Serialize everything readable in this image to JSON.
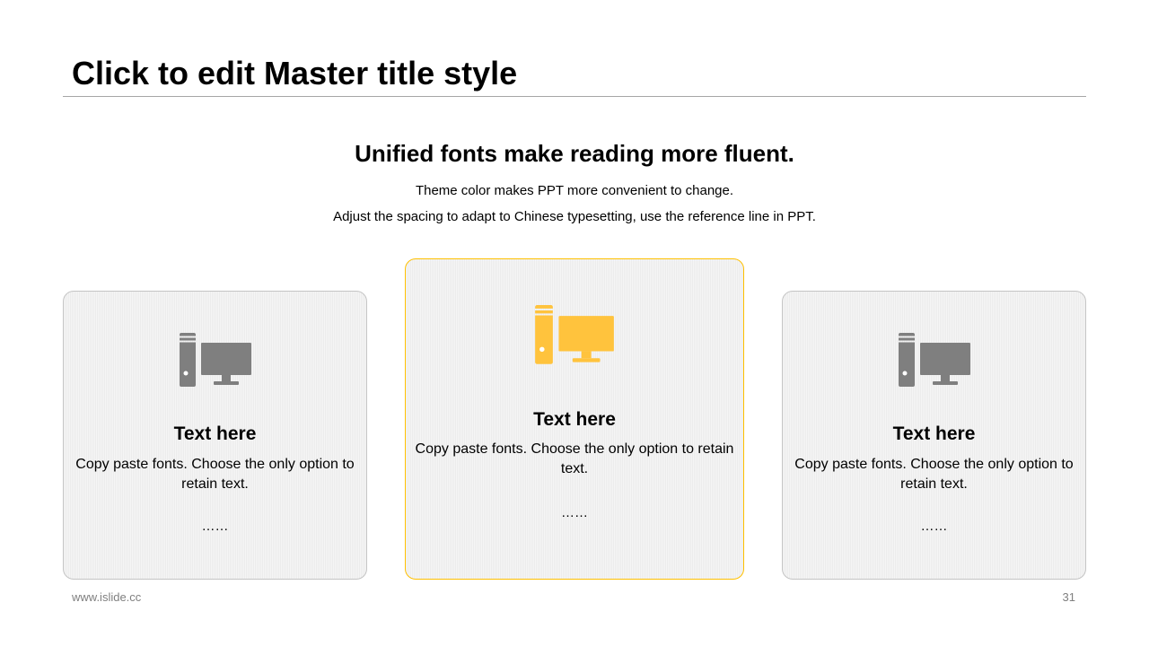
{
  "slide": {
    "title": "Click to edit Master title style",
    "subtitle": "Unified fonts make reading more fluent.",
    "description": [
      "Theme color makes PPT more convenient to change.",
      "Adjust the spacing to adapt to Chinese typesetting, use the reference line in PPT."
    ]
  },
  "cards": [
    {
      "icon": "desktop-computer-icon",
      "heading": "Text here",
      "body": "Copy paste fonts. Choose the only option to retain text.",
      "more": "……",
      "highlighted": false
    },
    {
      "icon": "desktop-computer-icon",
      "heading": "Text here",
      "body": "Copy paste fonts. Choose the only option to retain text.",
      "more": "……",
      "highlighted": true
    },
    {
      "icon": "desktop-computer-icon",
      "heading": "Text here",
      "body": "Copy paste fonts. Choose the only option to retain text.",
      "more": "……",
      "highlighted": false
    }
  ],
  "footer": {
    "url": "www.islide.cc",
    "page_number": "31"
  },
  "colors": {
    "accent": "#FFC33D",
    "icon_neutral": "#7F7F7F",
    "highlight_border": "#FFC000",
    "card_border": "#C4C4C4",
    "title_rule": "#A6A6A6"
  }
}
